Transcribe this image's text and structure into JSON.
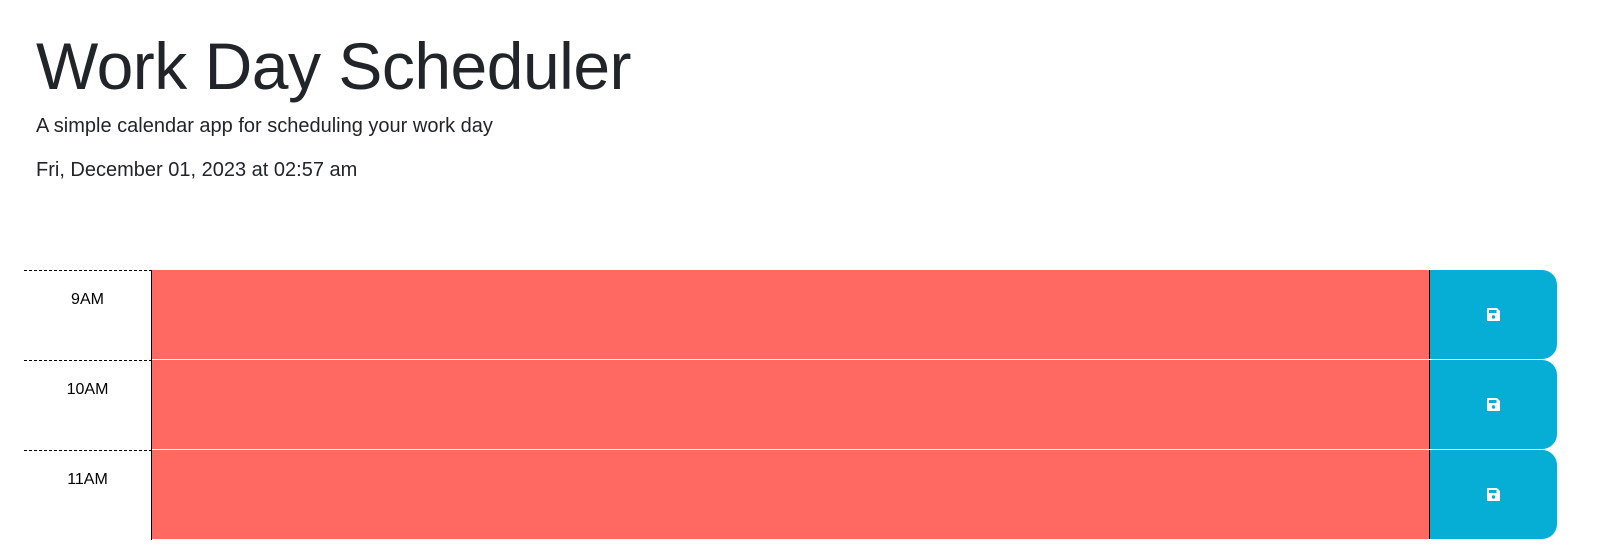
{
  "header": {
    "title": "Work Day Scheduler",
    "lead": "A simple calendar app for scheduling your work day",
    "current_date": "Fri, December 01, 2023 at 02:57 am"
  },
  "schedule": {
    "rows": [
      {
        "hour": "9AM",
        "description": "",
        "status": "past"
      },
      {
        "hour": "10AM",
        "description": "",
        "status": "past"
      },
      {
        "hour": "11AM",
        "description": "",
        "status": "past"
      }
    ]
  },
  "colors": {
    "past": "#ff6961",
    "save_button": "#06aed5"
  },
  "icons": {
    "save": "floppy-disk-icon"
  }
}
